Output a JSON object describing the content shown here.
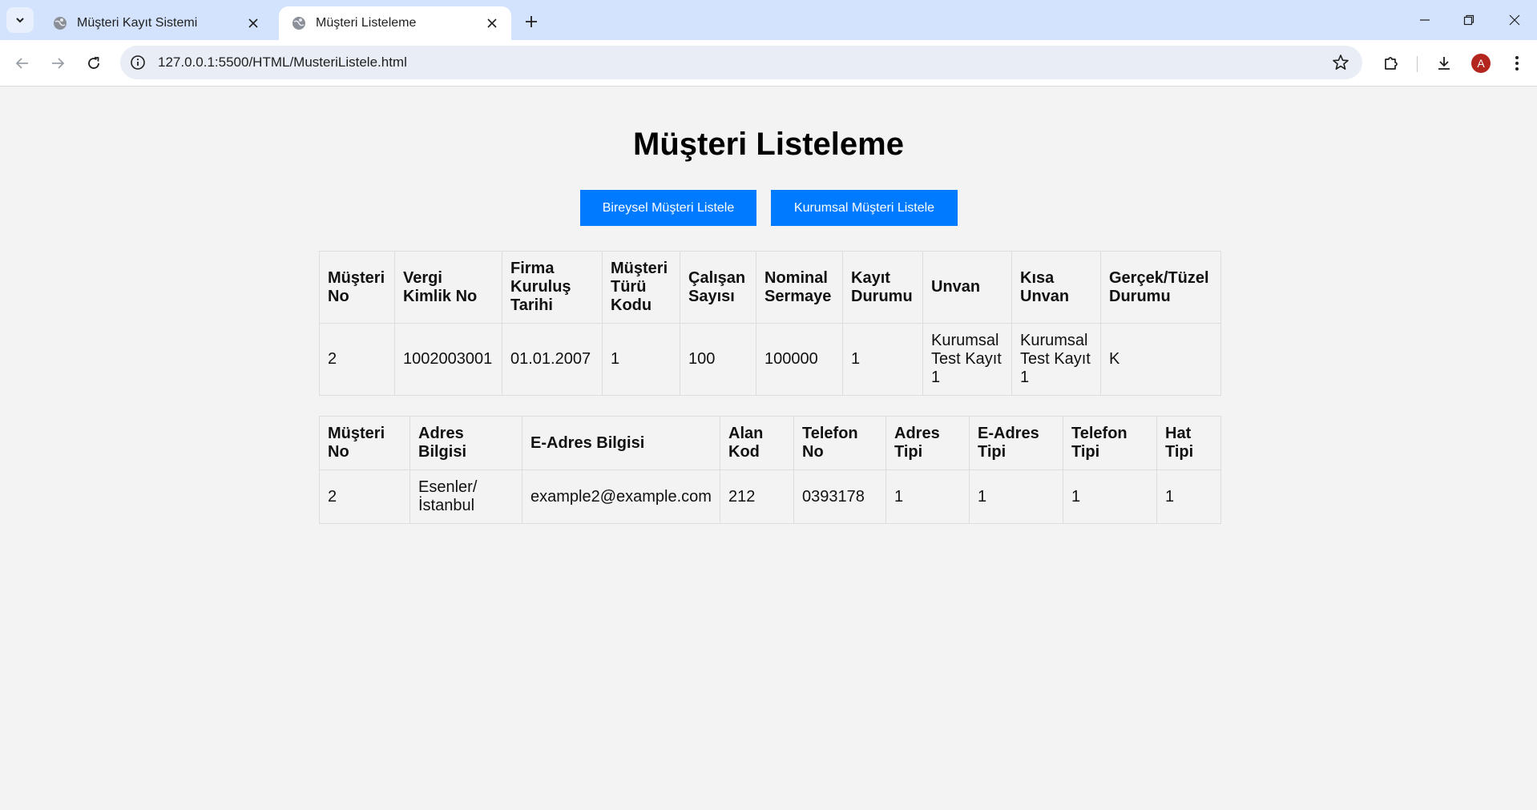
{
  "browser": {
    "tabs": [
      {
        "title": "Müşteri Kayıt Sistemi",
        "active": false
      },
      {
        "title": "Müşteri Listeleme",
        "active": true
      }
    ],
    "url": "127.0.0.1:5500/HTML/MusteriListele.html",
    "profile_initial": "A"
  },
  "page": {
    "title": "Müşteri Listeleme",
    "buttons": {
      "individual": "Bireysel Müşteri Listele",
      "corporate": "Kurumsal Müşteri Listele"
    },
    "accent_color": "#007bff"
  },
  "customer_table": {
    "headers": [
      "Müşteri No",
      "Vergi Kimlik No",
      "Firma Kuruluş Tarihi",
      "Müşteri Türü Kodu",
      "Çalışan Sayısı",
      "Nominal Sermaye",
      "Kayıt Durumu",
      "Unvan",
      "Kısa Unvan",
      "Gerçek/Tüzel Durumu"
    ],
    "rows": [
      [
        "2",
        "1002003001",
        "01.01.2007",
        "1",
        "100",
        "100000",
        "1",
        "Kurumsal Test Kayıt 1",
        "Kurumsal Test Kayıt 1",
        "K"
      ]
    ]
  },
  "address_table": {
    "headers": [
      "Müşteri No",
      "Adres Bilgisi",
      "E-Adres Bilgisi",
      "Alan Kod",
      "Telefon No",
      "Adres Tipi",
      "E-Adres Tipi",
      "Telefon Tipi",
      "Hat Tipi"
    ],
    "rows": [
      [
        "2",
        "Esenler/ İstanbul",
        "example2@example.com",
        "212",
        "0393178",
        "1",
        "1",
        "1",
        "1"
      ]
    ]
  }
}
